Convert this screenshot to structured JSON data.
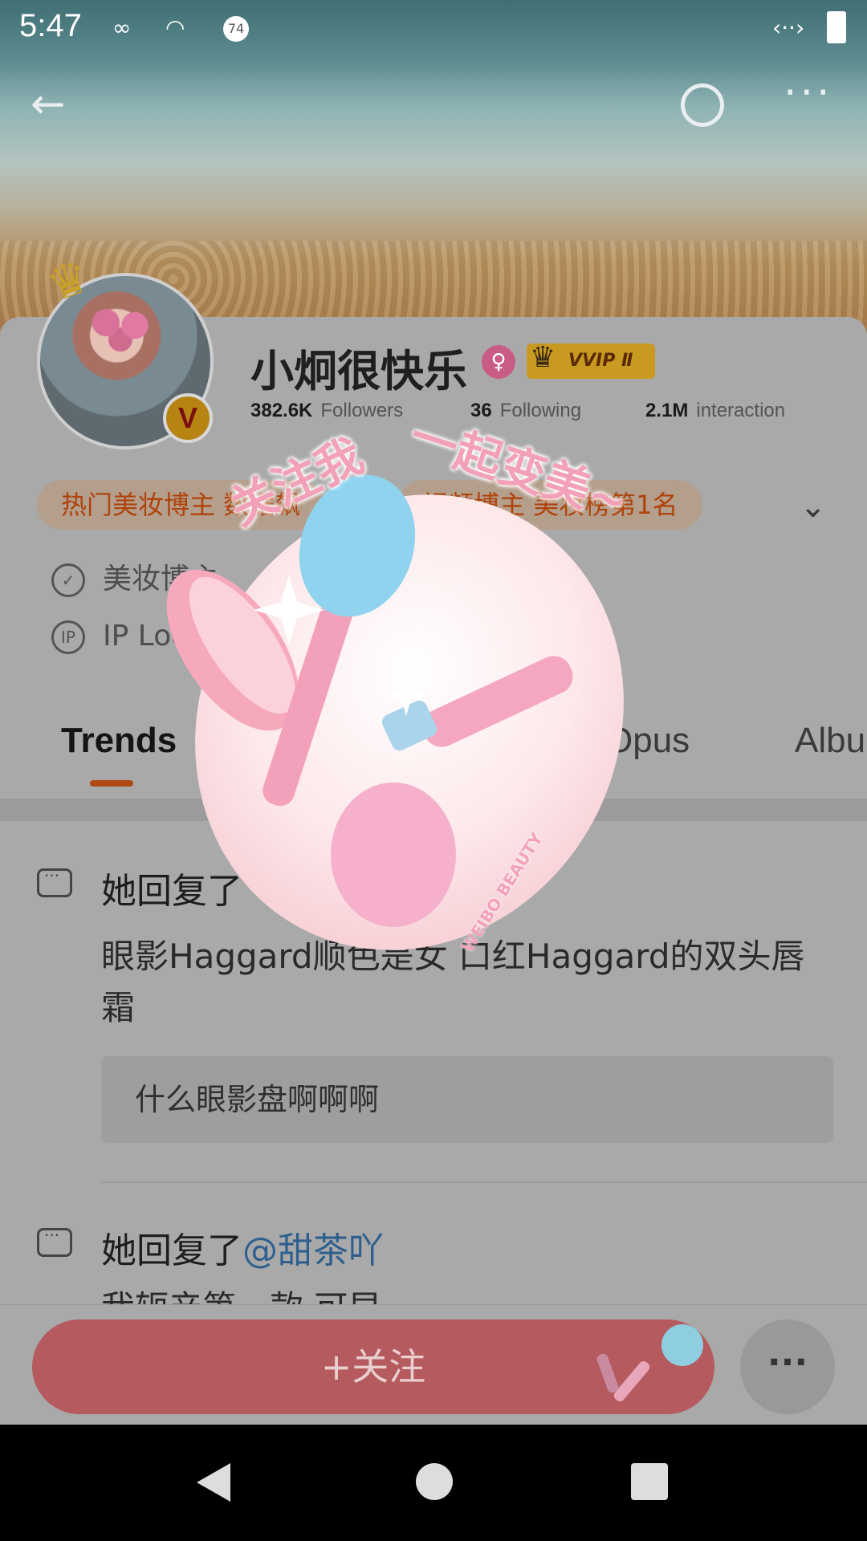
{
  "status": {
    "time": "5:47",
    "badge": "74",
    "icons": [
      "infinity-icon",
      "speedometer-icon",
      "badge-74-icon",
      "code-icon",
      "battery-icon"
    ]
  },
  "profile": {
    "name": "小炯很快乐",
    "vip_label": "VVIP Ⅱ",
    "verified_letter": "V",
    "followers_value": "382.6K",
    "followers_label": "Followers",
    "following_value": "36",
    "following_label": "Following",
    "interaction_value": "2.1M",
    "interaction_label": "interaction",
    "tags": [
      "热门美妆博主 数据飙",
      "视频博主 美妆榜第1名"
    ],
    "category": "美妆博主",
    "ip_location": "IP Location"
  },
  "tabs": [
    "Trends",
    "Opus",
    "Albu"
  ],
  "feed": [
    {
      "title_prefix": "她回复了",
      "body": "眼影Haggard顺色是女 口红Haggard的双头唇霜",
      "quote": "什么眼影盘啊啊啊"
    },
    {
      "title_prefix": "她回复了",
      "mention": "@甜茶吖",
      "body": "我轭产第一款 可早"
    }
  ],
  "bottom": {
    "follow_label": "+关注",
    "more_label": "···"
  },
  "promo": {
    "text_left": "关注我",
    "text_right": "一起变美~",
    "brand": "WEIBO BEAUTY"
  },
  "colors": {
    "accent": "#e36a6e",
    "tag_text": "#b0420a",
    "mention": "#2f5f8f",
    "vip_gold": "#c99a21"
  }
}
